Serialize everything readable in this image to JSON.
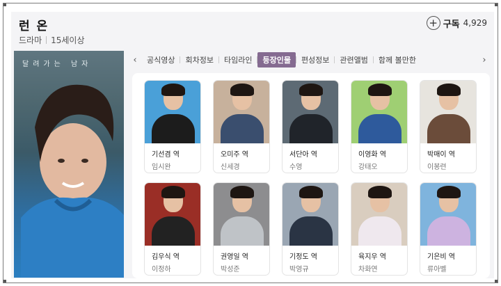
{
  "header": {
    "title": "런 온",
    "genre": "드라마",
    "rating": "15세이상",
    "subscribe_icon": "plus-circle-icon",
    "subscribe_label": "구독",
    "subscribe_count": "4,929"
  },
  "poster": {
    "title_text": "달려가는 남자"
  },
  "tabs": {
    "prev_icon": "chevron-left-icon",
    "next_icon": "chevron-right-icon",
    "items": [
      {
        "label": "공식영상"
      },
      {
        "label": "회차정보"
      },
      {
        "label": "타임라인"
      },
      {
        "label": "등장인물"
      },
      {
        "label": "편성정보"
      },
      {
        "label": "관련앨범"
      },
      {
        "label": "함께 볼만한"
      }
    ],
    "active": "등장인물"
  },
  "cast": [
    {
      "role": "기선겸 역",
      "actor": "임시완",
      "bg": "#4aa0d8",
      "top": "#1c1c1c"
    },
    {
      "role": "오미주 역",
      "actor": "신세경",
      "bg": "#c7b19c",
      "top": "#3a4e6e"
    },
    {
      "role": "서단아 역",
      "actor": "수영",
      "bg": "#5d6a74",
      "top": "#20242a"
    },
    {
      "role": "이영화 역",
      "actor": "강태오",
      "bg": "#9fcf73",
      "top": "#2e5a9c"
    },
    {
      "role": "박매이 역",
      "actor": "이봉련",
      "bg": "#e7e4de",
      "top": "#6b4c3a"
    },
    {
      "role": "김우식 역",
      "actor": "이정하",
      "bg": "#9a2e26",
      "top": "#222222"
    },
    {
      "role": "권영일 역",
      "actor": "박성준",
      "bg": "#8d8d8f",
      "top": "#bfc3c7"
    },
    {
      "role": "기정도 역",
      "actor": "박영규",
      "bg": "#9aa6b3",
      "top": "#2a3444"
    },
    {
      "role": "육지우 역",
      "actor": "차화연",
      "bg": "#d9cdbf",
      "top": "#efe8ee"
    },
    {
      "role": "기은비 역",
      "actor": "류아벨",
      "bg": "#7fb4dd",
      "top": "#cdb3e0"
    }
  ]
}
